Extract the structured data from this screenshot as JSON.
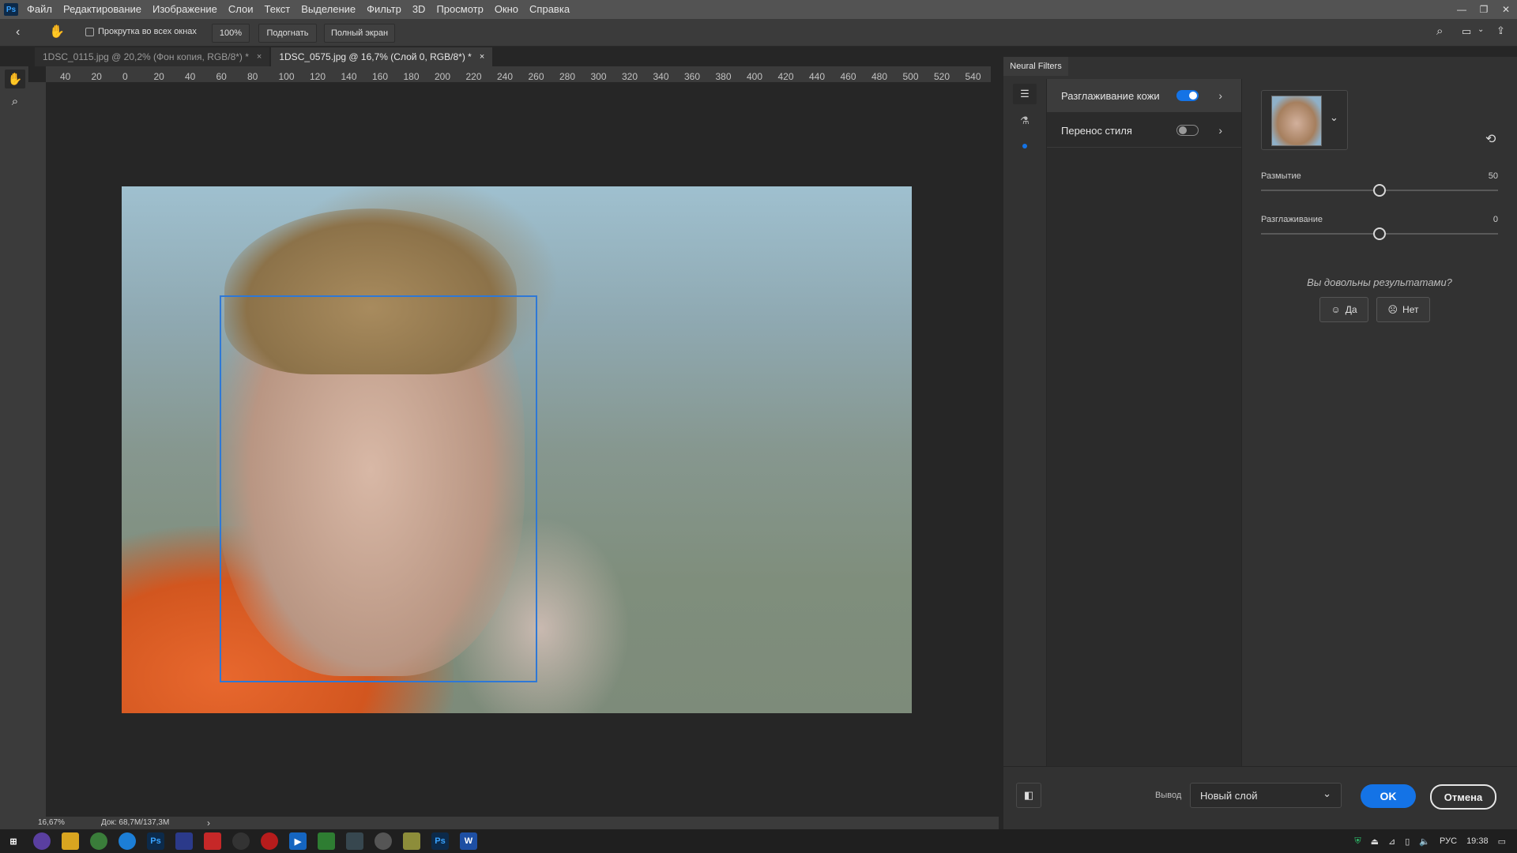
{
  "app": {
    "logo": "Ps",
    "menu": [
      "Файл",
      "Редактирование",
      "Изображение",
      "Слои",
      "Текст",
      "Выделение",
      "Фильтр",
      "3D",
      "Просмотр",
      "Окно",
      "Справка"
    ]
  },
  "options": {
    "scroll_all_windows": "Прокрутка во всех окнах",
    "zoom_value": "100%",
    "fit_label": "Подогнать",
    "fullscreen_label": "Полный экран"
  },
  "tabs": [
    {
      "label": "1DSC_0115.jpg @ 20,2% (Фон копия, RGB/8*) *",
      "close": "×"
    },
    {
      "label": "1DSC_0575.jpg @ 16,7% (Слой 0, RGB/8*) *",
      "close": "×"
    }
  ],
  "ruler": {
    "h_ticks": [
      "40",
      "20",
      "0",
      "20",
      "40",
      "60",
      "80",
      "100",
      "120",
      "140",
      "160",
      "180",
      "200",
      "220",
      "240",
      "260",
      "280",
      "300",
      "320",
      "340",
      "360",
      "380",
      "400",
      "420",
      "440",
      "460",
      "480",
      "500",
      "520",
      "540"
    ]
  },
  "panel": {
    "tab_title": "Neural Filters",
    "filters": [
      {
        "label": "Разглаживание кожи",
        "on": true
      },
      {
        "label": "Перенос стиля",
        "on": false
      }
    ],
    "sliders": [
      {
        "label": "Размытие",
        "value": "50",
        "fraction": 0.5
      },
      {
        "label": "Разглаживание",
        "value": "0",
        "fraction": 0.5
      }
    ],
    "feedback_question": "Вы довольны результатами?",
    "yes_label": "Да",
    "no_label": "Нет",
    "output_label": "Вывод",
    "output_value": "Новый слой",
    "ok_label": "OK",
    "cancel_label": "Отмена"
  },
  "status": {
    "zoom": "16,67%",
    "doc": "Док: 68,7M/137,3M"
  },
  "taskbar": {
    "lang": "РУС",
    "time": "19:38"
  },
  "colors": {
    "accent": "#1473e6",
    "facebox": "#2e78d6"
  }
}
